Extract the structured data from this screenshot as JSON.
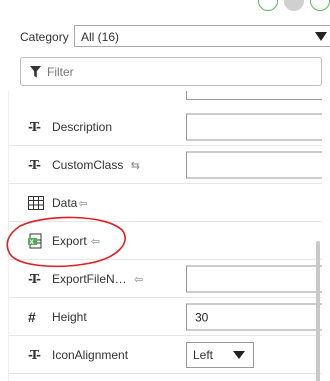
{
  "category": {
    "label": "Category",
    "selected": "All (16)"
  },
  "filter": {
    "placeholder": "Filter"
  },
  "properties": [
    {
      "label": "Description",
      "icon": "text-type-icon",
      "hint": "",
      "value": ""
    },
    {
      "label": "CustomClass",
      "icon": "text-type-icon",
      "hint": "bidirectional-binding-icon",
      "value": ""
    },
    {
      "label": "Data",
      "icon": "table-icon",
      "hint": "binding-in-icon"
    },
    {
      "label": "Export",
      "icon": "export-icon",
      "hint": "binding-in-icon"
    },
    {
      "label": "ExportFileN…",
      "icon": "text-type-icon",
      "hint": "binding-in-icon",
      "value": ""
    },
    {
      "label": "Height",
      "icon": "number-icon",
      "hint": "",
      "value": "30"
    },
    {
      "label": "IconAlignment",
      "icon": "text-type-icon",
      "hint": "",
      "value": "Left"
    }
  ],
  "annotation_color": "#e02020",
  "accent_green": "#5cb85c"
}
